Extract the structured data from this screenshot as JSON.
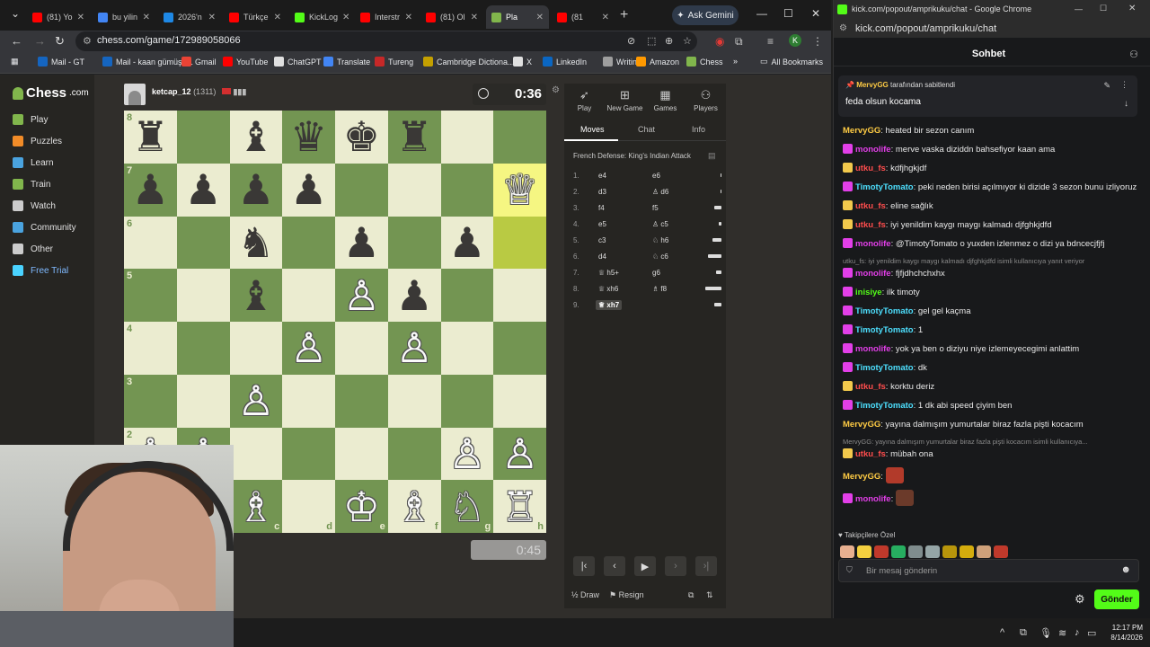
{
  "browser_left": {
    "tabs": [
      {
        "label": "(81) Yo",
        "color": "#ff0000"
      },
      {
        "label": "bu yilin",
        "color": "#4285f4"
      },
      {
        "label": "2026'n",
        "color": "#1e88e5"
      },
      {
        "label": "Türkçe",
        "color": "#ff0000"
      },
      {
        "label": "KickLog",
        "color": "#53fc18"
      },
      {
        "label": "Interstr",
        "color": "#ff0000"
      },
      {
        "label": "(81) Ol",
        "color": "#ff0000"
      },
      {
        "label": "Pla",
        "color": "#81b64c"
      },
      {
        "label": "(81",
        "color": "#ff0000"
      }
    ],
    "gemini_label": "Ask Gemini",
    "url": "chess.com/game/172989058066",
    "profile_letter": "K",
    "bookmarks": [
      {
        "label": "Mail - GT",
        "color": "#1565c0"
      },
      {
        "label": "Mail - kaan gümüşd...",
        "color": "#1565c0"
      },
      {
        "label": "Gmail",
        "color": "#ea4335"
      },
      {
        "label": "YouTube",
        "color": "#ff0000"
      },
      {
        "label": "ChatGPT",
        "color": "#e0e0e0"
      },
      {
        "label": "Translate",
        "color": "#4285f4"
      },
      {
        "label": "Tureng",
        "color": "#c62828"
      },
      {
        "label": "Cambridge Dictiona...",
        "color": "#c4a000"
      },
      {
        "label": "X",
        "color": "#e0e0e0"
      },
      {
        "label": "LinkedIn",
        "color": "#0a66c2"
      },
      {
        "label": "Writing",
        "color": "#9e9e9e"
      },
      {
        "label": "Amazon",
        "color": "#ff9900"
      },
      {
        "label": "Chess",
        "color": "#81b64c"
      }
    ],
    "all_bookmarks": "All Bookmarks"
  },
  "chess": {
    "logo": "Chess",
    "logo_suffix": ".com",
    "nav": [
      {
        "label": "Play",
        "color": "#81b64c"
      },
      {
        "label": "Puzzles",
        "color": "#f28c28"
      },
      {
        "label": "Learn",
        "color": "#4aa3df"
      },
      {
        "label": "Train",
        "color": "#81b64c"
      },
      {
        "label": "Watch",
        "color": "#cccccc"
      },
      {
        "label": "Community",
        "color": "#4aa3df"
      },
      {
        "label": "Other",
        "color": "#cccccc"
      },
      {
        "label": "Free Trial",
        "color": "#4ad3ff"
      }
    ],
    "opponent": {
      "name": "ketcap_12",
      "rating": "(1311)"
    },
    "clock_top": "0:36",
    "clock_bottom": "0:45",
    "board": {
      "ranks": [
        [
          "r",
          "",
          "b",
          "q",
          "k",
          "r",
          "",
          ""
        ],
        [
          "p",
          "p",
          "p",
          "p",
          "",
          "",
          "",
          "Q"
        ],
        [
          "",
          "",
          "n",
          "",
          "p",
          "",
          "p",
          ""
        ],
        [
          "",
          "",
          "b",
          "",
          "P",
          "p",
          "",
          ""
        ],
        [
          "",
          "",
          "",
          "P",
          "",
          "P",
          "",
          ""
        ],
        [
          "",
          "",
          "P",
          "",
          "",
          "",
          "",
          ""
        ],
        [
          "P",
          "P",
          "",
          "",
          "",
          "",
          "P",
          "P"
        ],
        [
          "R",
          "N",
          "B",
          "",
          "K",
          "B",
          "N",
          "R"
        ]
      ],
      "highlight": [
        [
          1,
          7
        ],
        [
          2,
          7
        ]
      ],
      "rank_labels": [
        "8",
        "7",
        "6",
        "5",
        "4",
        "3",
        "2",
        "1"
      ],
      "file_labels": [
        "a",
        "b",
        "c",
        "d",
        "e",
        "f",
        "g",
        "h"
      ]
    },
    "panel_nav": [
      {
        "label": "Play",
        "icon": "rocket-icon"
      },
      {
        "label": "New Game",
        "icon": "plus-icon"
      },
      {
        "label": "Games",
        "icon": "grid-icon"
      },
      {
        "label": "Players",
        "icon": "players-icon"
      }
    ],
    "panel_tabs": [
      "Moves",
      "Chat",
      "Info"
    ],
    "opening": "French Defense: King's Indian Attack",
    "moves": [
      {
        "n": "1.",
        "w": "e4",
        "b": "e6",
        "bar": 1
      },
      {
        "n": "2.",
        "w": "d3",
        "b": "♙ d6",
        "bar": 1
      },
      {
        "n": "3.",
        "w": "f4",
        "b": "f5",
        "bar": 8
      },
      {
        "n": "4.",
        "w": "e5",
        "b": "♙ c5",
        "bar": 3
      },
      {
        "n": "5.",
        "w": "c3",
        "b": "♘ h6",
        "bar": 10
      },
      {
        "n": "6.",
        "w": "d4",
        "b": "♘ c6",
        "bar": 15
      },
      {
        "n": "7.",
        "w": "♕ h5+",
        "b": "g6",
        "bar": 6
      },
      {
        "n": "8.",
        "w": "♕ xh6",
        "b": "♗ f8",
        "bar": 18
      },
      {
        "n": "9.",
        "w": "♕ xh7",
        "b": "",
        "bar": 8
      }
    ],
    "draw_label": "Draw",
    "resign_label": "Resign"
  },
  "kick": {
    "window_title": "kick.com/popout/amprikuku/chat - Google Chrome",
    "url": "kick.com/popout/amprikuku/chat",
    "header": "Sohbet",
    "pinned_by_user": "MervyGG",
    "pinned_by_text": "tarafından sabitlendi",
    "pinned_message": "feda olsun kocama",
    "messages": [
      {
        "user": "MervyGG",
        "color": "#ffcc44",
        "badge": "",
        "text": "heated bir sezon canım"
      },
      {
        "user": "monolife",
        "color": "#e23fe8",
        "badge": "#e23fe8",
        "text": "merve vaska diziddn bahsefiyor kaan ama"
      },
      {
        "user": "utku_fs",
        "color": "#ff4d4d",
        "badge": "#f2c94c",
        "text": "kdfjhgkjdf"
      },
      {
        "user": "TimotyTomato",
        "color": "#4de0ff",
        "badge": "#e23fe8",
        "text": "peki neden birisi açılmıyor ki dizide 3 sezon bunu izliyoruz"
      },
      {
        "user": "utku_fs",
        "color": "#ff4d4d",
        "badge": "#f2c94c",
        "text": "eline sağlık"
      },
      {
        "user": "utku_fs",
        "color": "#ff4d4d",
        "badge": "#f2c94c",
        "text": "iyi yenildim kaygı maygı kalmadı djfghkjdfd"
      },
      {
        "user": "monolife",
        "color": "#e23fe8",
        "badge": "#e23fe8",
        "text": "@TimotyTomato o yuxden izlenmez o dizi ya bdncecjfjfj"
      },
      {
        "user": "monolife",
        "color": "#e23fe8",
        "badge": "#e23fe8",
        "reply": "utku_fs: iyi yenildim kaygı maygı kalmadı djfghkjdfd isimli kullanıcıya yanıt veriyor",
        "text": "fjfjdhchchxhx"
      },
      {
        "user": "inisiye",
        "color": "#53fc18",
        "badge": "#e23fe8",
        "text": "ilk timoty"
      },
      {
        "user": "TimotyTomato",
        "color": "#4de0ff",
        "badge": "#e23fe8",
        "text": "gel gel kaçma"
      },
      {
        "user": "TimotyTomato",
        "color": "#4de0ff",
        "badge": "#e23fe8",
        "text": "1"
      },
      {
        "user": "monolife",
        "color": "#e23fe8",
        "badge": "#e23fe8",
        "text": "yok ya ben o diziyu niye izlemeyecegimi anlattim"
      },
      {
        "user": "TimotyTomato",
        "color": "#4de0ff",
        "badge": "#e23fe8",
        "text": "dk"
      },
      {
        "user": "utku_fs",
        "color": "#ff4d4d",
        "badge": "#f2c94c",
        "text": "korktu deriz"
      },
      {
        "user": "TimotyTomato",
        "color": "#4de0ff",
        "badge": "#e23fe8",
        "text": "1 dk abi speed çiyim ben"
      },
      {
        "user": "MervyGG",
        "color": "#ffcc44",
        "badge": "",
        "text": "yayına dalmışım yumurtalar biraz fazla pişti kocacım"
      },
      {
        "user": "utku_fs",
        "color": "#ff4d4d",
        "badge": "#f2c94c",
        "reply": "MervyGG: yayına dalmışım yumurtalar biraz fazla pişti kocacım isimli kullanıcıya...",
        "text": "mübah ona"
      },
      {
        "user": "MervyGG",
        "color": "#ffcc44",
        "badge": "",
        "text": "",
        "emote": "#b23a2a"
      },
      {
        "user": "monolife",
        "color": "#e23fe8",
        "badge": "#e23fe8",
        "text": "",
        "emote": "#6b3a2a"
      }
    ],
    "emote_label": "Takipçilere Özel",
    "emote_colors": [
      "#e8b090",
      "#f4d03f",
      "#c0392b",
      "#27ae60",
      "#7f8c8d",
      "#95a5a6",
      "#b7950b",
      "#d4ac0d",
      "#cfa17a",
      "#c0392b"
    ],
    "input_placeholder": "Bir mesaj gönderin",
    "send_label": "Gönder"
  },
  "system": {
    "time": "12:17 PM",
    "date": "8/14/2026"
  }
}
